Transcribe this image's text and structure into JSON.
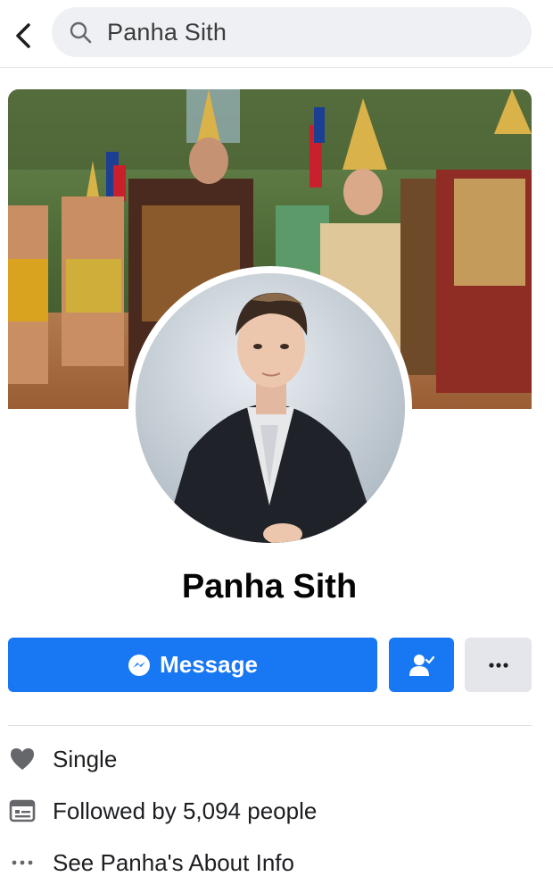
{
  "search": {
    "query": "Panha Sith"
  },
  "profile": {
    "name": "Panha Sith"
  },
  "actions": {
    "message_label": "Message"
  },
  "info": [
    {
      "icon": "heart-icon",
      "text": "Single"
    },
    {
      "icon": "followers-icon",
      "text": "Followed by 5,094 people"
    },
    {
      "icon": "more-dots-icon",
      "text": "See Panha's About Info"
    }
  ],
  "colors": {
    "accent": "#1877f2",
    "secondary_button": "#e4e6eb",
    "search_bg": "#eef0f3"
  }
}
